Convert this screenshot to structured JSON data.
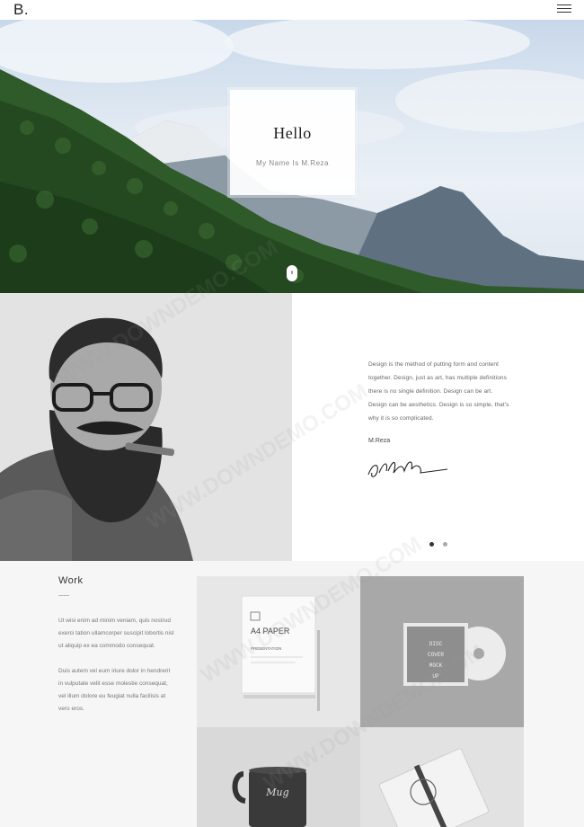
{
  "header": {
    "logo": "B.",
    "menu_icon": "hamburger-icon"
  },
  "hero": {
    "title": "Hello",
    "subtitle": "My Name Is M.Reza",
    "scroll_icon": "scroll-down-icon"
  },
  "about": {
    "quote": "Design is the method of putting form and content together. Design, just as art, has multiple definitions there is no single definition. Design can be art. Design can be aesthetics. Design is so simple, that's why it is so complicated.",
    "author": "M.Reza",
    "slider": {
      "count": 2,
      "active": 1
    }
  },
  "work": {
    "title": "Work",
    "paragraph1": "Ut wisi enim ad minim veniam, quis nostrud exerci tation ullamcorper suscipit lobortis nisl ut aliquip ex ea commodo consequat.",
    "paragraph2": "Duis autem vel eum iriure dolor in hendrerit in vulputate velit esse molestie consequat, vel illum dolore eu feugiat nulla facilisis at vero eros.",
    "tiles": [
      {
        "name": "A4 PAPER",
        "caption": "PRESENTATION"
      },
      {
        "name": "DISC COVER MOCK UP"
      },
      {
        "name": "Mug"
      },
      {
        "name": "Notebook"
      }
    ]
  },
  "watermark": "WWW.DOWNDEMO.COM"
}
